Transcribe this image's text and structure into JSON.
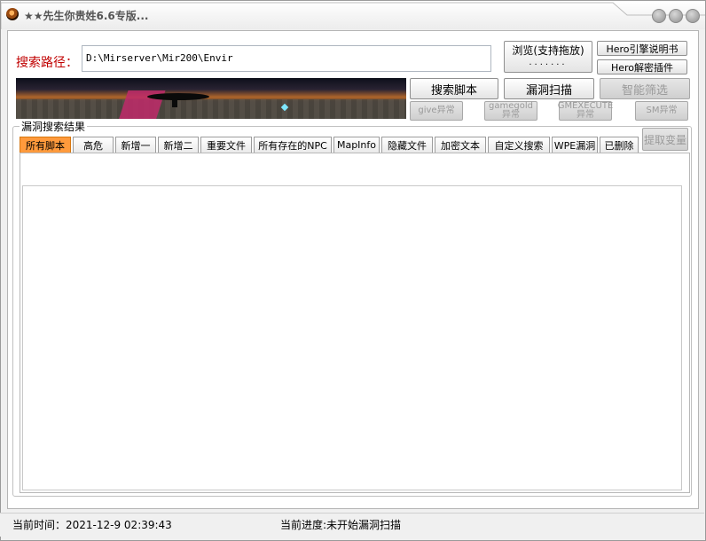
{
  "window": {
    "title": "★★先生你贵姓6.6专版..."
  },
  "path": {
    "label": "搜索路径：",
    "value": "D:\\Mirserver\\Mir200\\Envir"
  },
  "buttons": {
    "browse_line1": "浏览(支持拖放)",
    "browse_line2": ".......",
    "hero_manual": "Hero引擎说明书",
    "hero_decrypt": "Hero解密插件",
    "search_script": "搜索脚本",
    "vuln_scan": "漏洞扫描",
    "smart_filter": "智能筛选",
    "give_abnormal": "give异常",
    "gamegold_line1": "gamegold",
    "gamegold_line2": "异常",
    "gmexecute_line1": "GMEXECUTE",
    "gmexecute_line2": "异常",
    "sm_abnormal": "SM异常",
    "extract_var": "提取变量"
  },
  "results": {
    "group_title": "漏洞搜索结果",
    "tabs": [
      "所有脚本",
      "高危",
      "新增一",
      "新增二",
      "重要文件",
      "所有存在的NPC",
      "MapInfo",
      "隐藏文件",
      "加密文本",
      "自定义搜索",
      "WPE漏洞",
      "已删除"
    ],
    "active_tab": 0
  },
  "status": {
    "time": "当前时间：2021-12-9 02:39:43",
    "progress": "当前进度:未开始漏洞扫描"
  },
  "colors": {
    "path_label": "#c00000",
    "active_tab": "#ff9a3c"
  }
}
